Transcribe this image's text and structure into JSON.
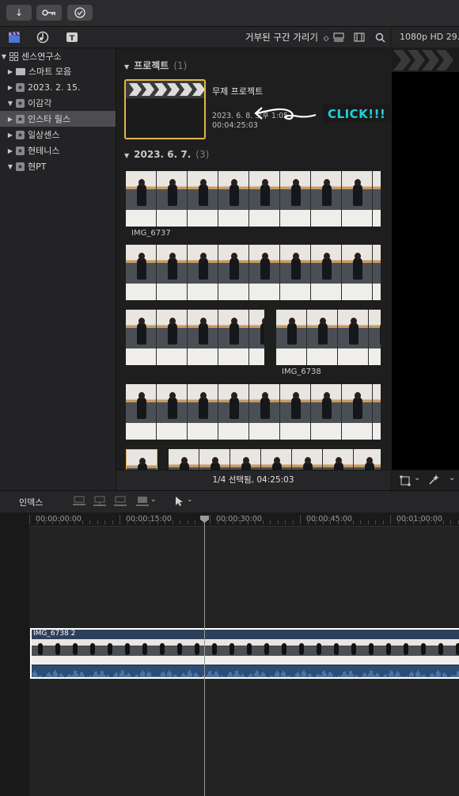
{
  "toolbar": {
    "buttons": [
      {
        "icon": "import-arrow-icon",
        "glyph": "↓"
      },
      {
        "icon": "keyword-key-icon",
        "glyph": "⊶"
      },
      {
        "icon": "checkmark-circle-icon",
        "glyph": "✓"
      }
    ]
  },
  "browser_toolbar": {
    "filter_label": "거부된 구간 가리기",
    "filter_chevron": "⌃⌄"
  },
  "viewer": {
    "format": "1080p HD 29.9"
  },
  "sidebar": {
    "items": [
      {
        "label": "센스연구소",
        "kind": "library",
        "expanded": true,
        "selected": false
      },
      {
        "label": "스마트 모음",
        "kind": "folder",
        "expanded": false,
        "selected": false
      },
      {
        "label": "2023. 2. 15.",
        "kind": "event",
        "expanded": false,
        "selected": false
      },
      {
        "label": "이감각",
        "kind": "event",
        "expanded": true,
        "selected": false
      },
      {
        "label": "인스타 릴스",
        "kind": "event",
        "expanded": false,
        "selected": true
      },
      {
        "label": "일상센스",
        "kind": "event",
        "expanded": false,
        "selected": false
      },
      {
        "label": "현테니스",
        "kind": "event",
        "expanded": false,
        "selected": false
      },
      {
        "label": "현PT",
        "kind": "event",
        "expanded": true,
        "selected": false
      }
    ]
  },
  "browser": {
    "project_section": {
      "title": "프로젝트",
      "count": "(1)"
    },
    "project": {
      "name": "무제 프로젝트",
      "date": "2023. 6. 8. 오후 1:05",
      "duration": "00:04:25:03"
    },
    "annotation": {
      "text": "CLICK!!!",
      "color": "#1fd0d8"
    },
    "date_section": {
      "title": "2023. 6. 7.",
      "count": "(3)"
    },
    "clips": [
      {
        "label": "IMG_6737"
      },
      {
        "label": "IMG_6738"
      }
    ],
    "status": "1/4 선택됨, 04:25:03"
  },
  "timeline": {
    "index_label": "인덱스",
    "ruler": [
      "00:00:00:00",
      "00:00:15:00",
      "00:00:30:00",
      "00:00:45:00",
      "00:01:00:00"
    ],
    "clip_name": "IMG_6738 2"
  },
  "colors": {
    "accent_selection": "#e3b548",
    "clip_border": "#ffffff",
    "audio": "#2c4d75"
  }
}
